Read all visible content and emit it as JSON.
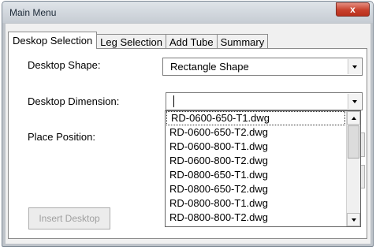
{
  "window": {
    "title": "Main Menu",
    "close_glyph": "x",
    "close_icon": "close-icon"
  },
  "tabs": [
    {
      "label": "Deskop Selection",
      "active": true
    },
    {
      "label": "Leg Selection",
      "active": false
    },
    {
      "label": "Add Tube",
      "active": false
    },
    {
      "label": "Summary",
      "active": false
    }
  ],
  "form": {
    "shape_label": "Desktop Shape:",
    "shape_value": "Rectangle Shape",
    "dimension_label": "Desktop Dimension:",
    "dimension_value": "",
    "position_label": "Place Position:"
  },
  "insert_button": {
    "label": "Insert Desktop",
    "enabled": false
  },
  "dropdown": {
    "items": [
      "RD-0600-650-T1.dwg",
      "RD-0600-650-T2.dwg",
      "RD-0600-800-T1.dwg",
      "RD-0600-800-T2.dwg",
      "RD-0800-650-T1.dwg",
      "RD-0800-650-T2.dwg",
      "RD-0800-800-T1.dwg",
      "RD-0800-800-T2.dwg"
    ],
    "highlighted_index": 0
  },
  "icons": {
    "combo_arrow": "chevron-down-icon",
    "scroll_up": "scroll-up-icon",
    "scroll_down": "scroll-down-icon"
  },
  "colors": {
    "close_button": "#c7402b",
    "window_frame": "#bfc4ca",
    "disabled_text": "#a0a0a0"
  }
}
